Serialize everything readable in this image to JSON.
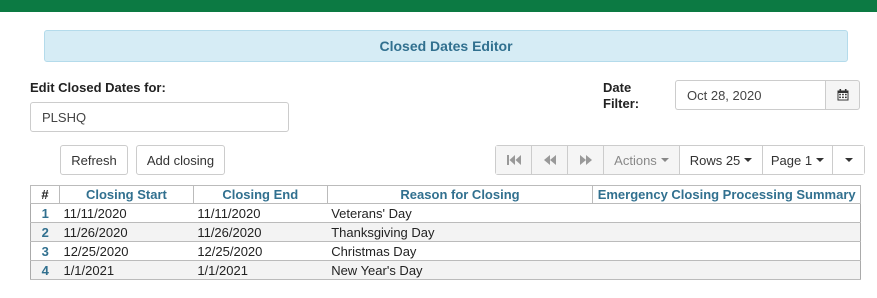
{
  "header": {
    "title": "Closed Dates Editor"
  },
  "location": {
    "label": "Edit Closed Dates for:",
    "value": "PLSHQ"
  },
  "date_filter": {
    "label": "Date Filter:",
    "value": "Oct 28, 2020"
  },
  "toolbar": {
    "refresh_label": "Refresh",
    "add_label": "Add closing"
  },
  "pager": {
    "actions_label": "Actions",
    "rows_label": "Rows 25",
    "page_label": "Page 1"
  },
  "table": {
    "columns": [
      "#",
      "Closing Start",
      "Closing End",
      "Reason for Closing",
      "Emergency Closing Processing Summary"
    ],
    "rows": [
      {
        "num": "1",
        "start": "11/11/2020",
        "end": "11/11/2020",
        "reason": "Veterans' Day",
        "summary": ""
      },
      {
        "num": "2",
        "start": "11/26/2020",
        "end": "11/26/2020",
        "reason": "Thanksgiving Day",
        "summary": ""
      },
      {
        "num": "3",
        "start": "12/25/2020",
        "end": "12/25/2020",
        "reason": "Christmas Day",
        "summary": ""
      },
      {
        "num": "4",
        "start": "1/1/2021",
        "end": "1/1/2021",
        "reason": "New Year's Day",
        "summary": ""
      }
    ]
  },
  "colors": {
    "topbar": "#0c7a43",
    "banner_bg": "#d6ecf5",
    "accent": "#31708f"
  },
  "icons": {
    "calendar": "calendar-icon",
    "first": "first-page-icon",
    "prev": "previous-page-icon",
    "next": "next-page-icon"
  }
}
